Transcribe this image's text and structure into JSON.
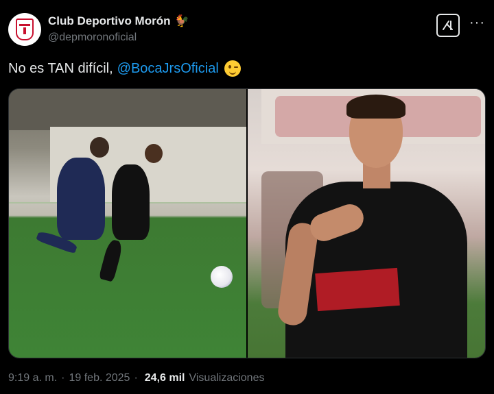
{
  "account": {
    "display_name": "Club Deportivo Morón",
    "handle": "@depmoronoficial"
  },
  "header": {
    "grok_icon": "grok-icon",
    "more_icon": "more-horizontal-icon",
    "more_glyph": "···"
  },
  "tweet": {
    "text": "No es TAN difícil,",
    "mention": "@BocaJrsOficial",
    "emoji": "winking-face-emoji"
  },
  "media": {
    "image_count": 2
  },
  "footer": {
    "time": "9:19 a. m.",
    "separator_1": "·",
    "date": "19 feb. 2025",
    "separator_2": "·",
    "views_count": "24,6 mil",
    "views_label": "Visualizaciones"
  },
  "colors": {
    "background": "#000000",
    "text": "#e7e9ea",
    "secondary": "#71767b",
    "link": "#1d9bf0"
  }
}
